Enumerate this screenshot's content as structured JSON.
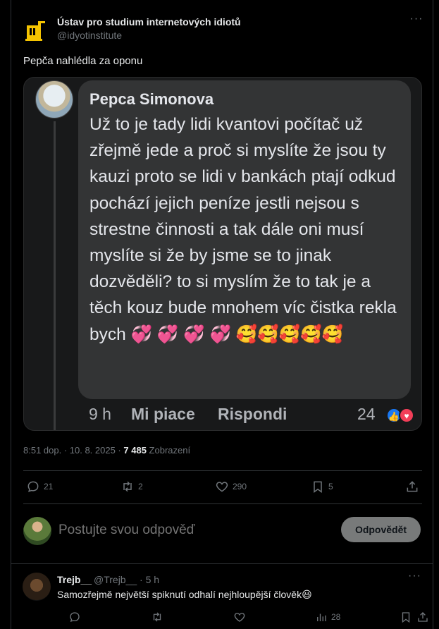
{
  "post": {
    "author_name": "Ústav pro studium internetových idiotů",
    "author_handle": "@idyotinstitute",
    "more_label": "···",
    "text": "Pepča nahlédla za oponu",
    "timestamp": "8:51 dop. · 10. 8. 2025 · ",
    "views_count": "7 485",
    "views_label": " Zobrazení"
  },
  "media": {
    "commenter_name": "Pepca Simonova",
    "comment_text": "Už to je tady lidi kvantovi počítač už zřejmě jede a proč si myslíte že jsou ty kauzi proto se lidi v bankách ptají odkud pochází jejich peníze jestli nejsou s strestne činnosti a tak dále oni musí myslíte si že by jsme se to jinak dozvěděli? to si myslím že to tak je a těch kouz bude mnohem víc čistka rekla bych 💞 💞 💞 💞 🥰🥰🥰🥰🥰",
    "time": "9 h",
    "like_label": "Mi piace",
    "reply_label": "Rispondi",
    "reaction_count": "24",
    "like_icon": "thumbs-up",
    "love_icon": "heart"
  },
  "actions": {
    "replies": "21",
    "reposts": "2",
    "likes": "290",
    "bookmarks": "5"
  },
  "reply_box": {
    "placeholder": "Postujte svou odpověď",
    "button_label": "Odpovědět"
  },
  "comment": {
    "name": "Trejb__",
    "handle": "@Trejb__ · 5 h",
    "more_label": "···",
    "text": "Samozřejmě největší spiknutí odhalí nejhloupější člověk😃",
    "views": "28"
  },
  "colors": {
    "background": "#000000",
    "border": "#2f3336",
    "muted_text": "#71767b",
    "fb_bubble": "#333435",
    "fb_like": "#1877f2",
    "fb_love": "#f33e58"
  }
}
